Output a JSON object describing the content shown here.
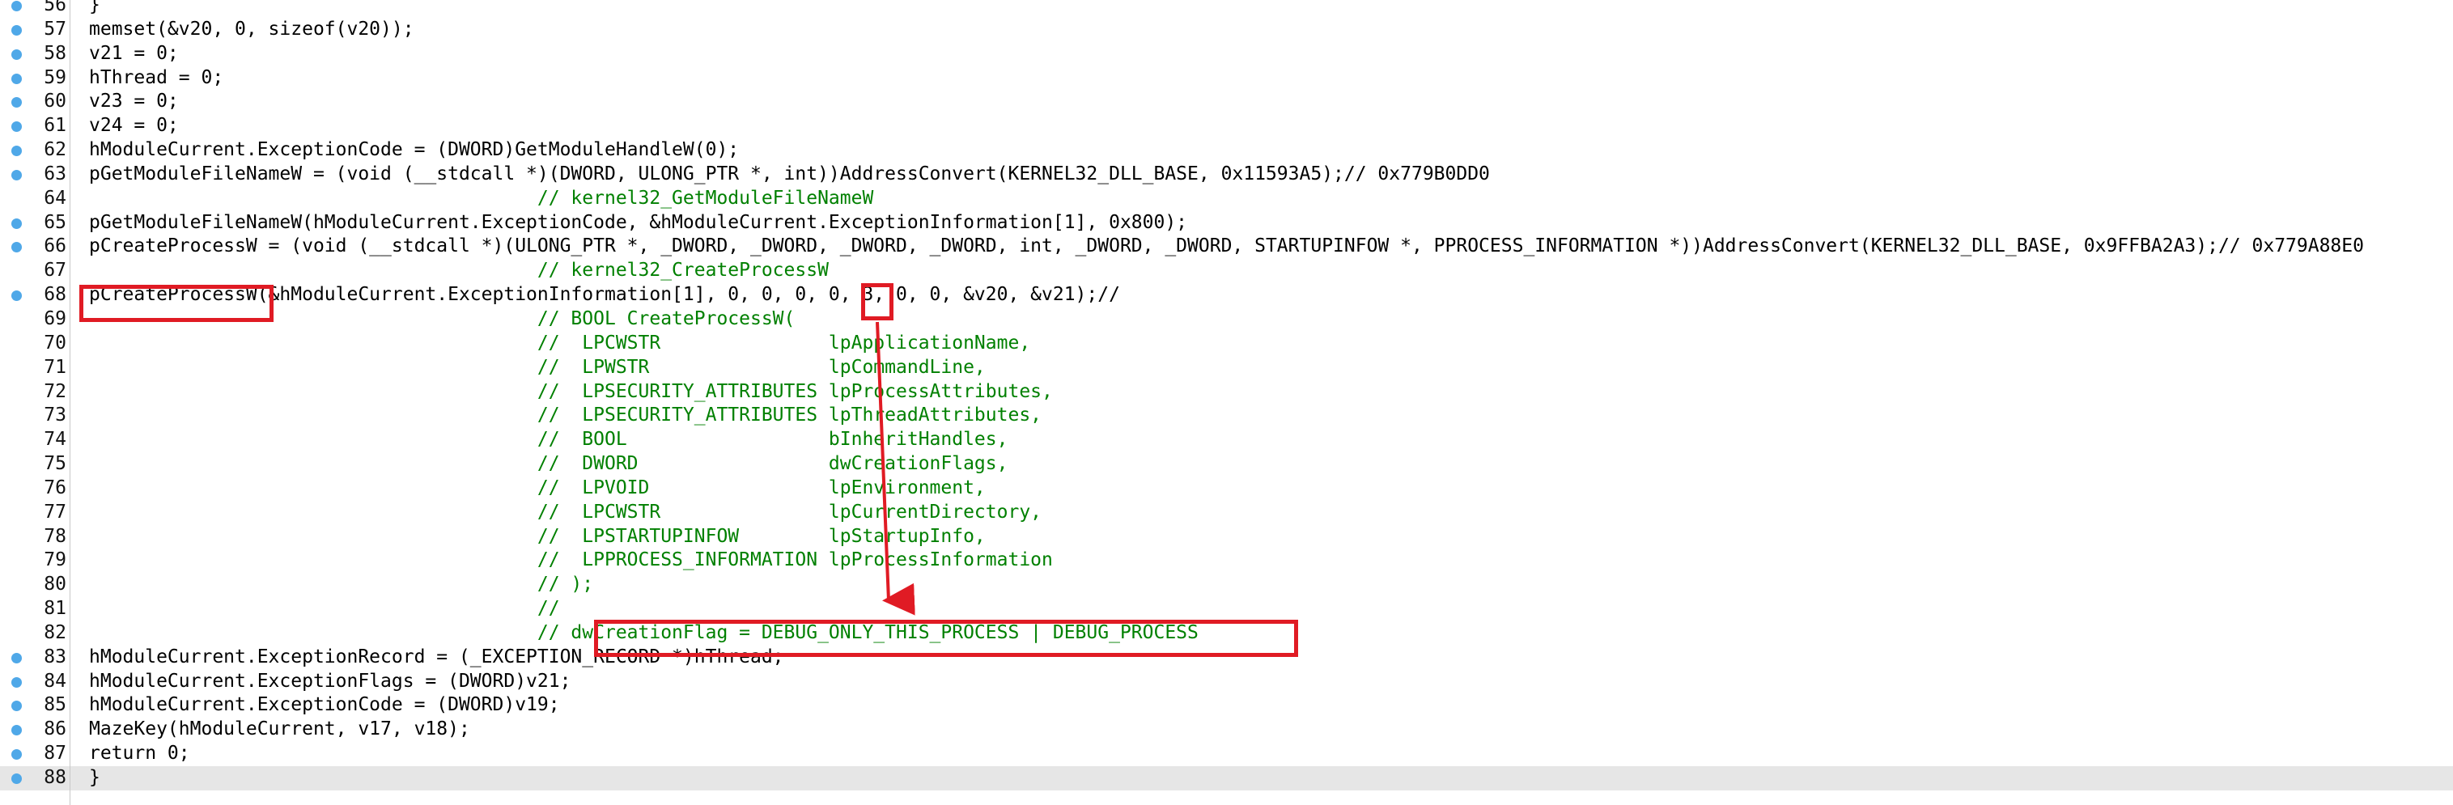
{
  "editor": {
    "current_line": 88,
    "breakpoint_color": "#4fa8e8",
    "annotation_color": "#e01b24"
  },
  "lines": [
    {
      "n": "56",
      "bp": true,
      "text": "}"
    },
    {
      "n": "57",
      "bp": true,
      "text": "memset(&v20, 0, sizeof(v20));"
    },
    {
      "n": "58",
      "bp": true,
      "text": "v21 = 0;"
    },
    {
      "n": "59",
      "bp": true,
      "text": "hThread = 0;"
    },
    {
      "n": "60",
      "bp": true,
      "text": "v23 = 0;"
    },
    {
      "n": "61",
      "bp": true,
      "text": "v24 = 0;"
    },
    {
      "n": "62",
      "bp": true,
      "text": "hModuleCurrent.ExceptionCode = (DWORD)GetModuleHandleW(0);"
    },
    {
      "n": "63",
      "bp": true,
      "text": "pGetModuleFileNameW = (void (__stdcall *)(DWORD, ULONG_PTR *, int))AddressConvert(KERNEL32_DLL_BASE, 0x11593A5);// 0x779B0DD0"
    },
    {
      "n": "64",
      "bp": false,
      "text": "                                        // kernel32_GetModuleFileNameW"
    },
    {
      "n": "65",
      "bp": true,
      "text": "pGetModuleFileNameW(hModuleCurrent.ExceptionCode, &hModuleCurrent.ExceptionInformation[1], 0x800);"
    },
    {
      "n": "66",
      "bp": true,
      "text": "pCreateProcessW = (void (__stdcall *)(ULONG_PTR *, _DWORD, _DWORD, _DWORD, _DWORD, int, _DWORD, _DWORD, STARTUPINFOW *, PPROCESS_INFORMATION *))AddressConvert(KERNEL32_DLL_BASE, 0x9FFBA2A3);// 0x779A88E0"
    },
    {
      "n": "67",
      "bp": false,
      "text": "                                        // kernel32_CreateProcessW"
    },
    {
      "n": "68",
      "bp": true,
      "text": "pCreateProcessW(&hModuleCurrent.ExceptionInformation[1], 0, 0, 0, 0, 3, 0, 0, &v20, &v21);//"
    },
    {
      "n": "69",
      "bp": false,
      "text": "                                        // BOOL CreateProcessW("
    },
    {
      "n": "70",
      "bp": false,
      "text": "                                        //  LPCWSTR               lpApplicationName,"
    },
    {
      "n": "71",
      "bp": false,
      "text": "                                        //  LPWSTR                lpCommandLine,"
    },
    {
      "n": "72",
      "bp": false,
      "text": "                                        //  LPSECURITY_ATTRIBUTES lpProcessAttributes,"
    },
    {
      "n": "73",
      "bp": false,
      "text": "                                        //  LPSECURITY_ATTRIBUTES lpThreadAttributes,"
    },
    {
      "n": "74",
      "bp": false,
      "text": "                                        //  BOOL                  bInheritHandles,"
    },
    {
      "n": "75",
      "bp": false,
      "text": "                                        //  DWORD                 dwCreationFlags,"
    },
    {
      "n": "76",
      "bp": false,
      "text": "                                        //  LPVOID                lpEnvironment,"
    },
    {
      "n": "77",
      "bp": false,
      "text": "                                        //  LPCWSTR               lpCurrentDirectory,"
    },
    {
      "n": "78",
      "bp": false,
      "text": "                                        //  LPSTARTUPINFOW        lpStartupInfo,"
    },
    {
      "n": "79",
      "bp": false,
      "text": "                                        //  LPPROCESS_INFORMATION lpProcessInformation"
    },
    {
      "n": "80",
      "bp": false,
      "text": "                                        // );"
    },
    {
      "n": "81",
      "bp": false,
      "text": "                                        //"
    },
    {
      "n": "82",
      "bp": false,
      "text": "                                        // dwCreationFlag = DEBUG_ONLY_THIS_PROCESS | DEBUG_PROCESS"
    },
    {
      "n": "83",
      "bp": true,
      "text": "hModuleCurrent.ExceptionRecord = (_EXCEPTION_RECORD *)hThread;"
    },
    {
      "n": "84",
      "bp": true,
      "text": "hModuleCurrent.ExceptionFlags = (DWORD)v21;"
    },
    {
      "n": "85",
      "bp": true,
      "text": "hModuleCurrent.ExceptionCode = (DWORD)v19;"
    },
    {
      "n": "86",
      "bp": true,
      "text": "MazeKey(hModuleCurrent, v17, v18);"
    },
    {
      "n": "87",
      "bp": true,
      "text": "return 0;"
    },
    {
      "n": "88",
      "bp": true,
      "text": "}"
    }
  ]
}
